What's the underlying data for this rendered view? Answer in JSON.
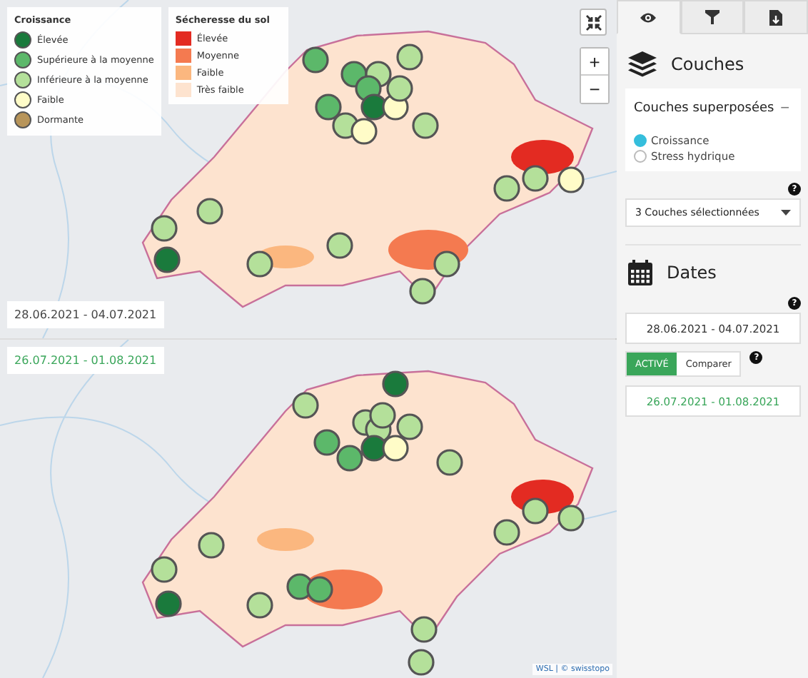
{
  "legend_growth": {
    "title": "Croissance",
    "items": [
      {
        "label": "Élevée",
        "color": "#1a7a3c"
      },
      {
        "label": "Supérieure à la moyenne",
        "color": "#5cb86a"
      },
      {
        "label": "Inférieure à la moyenne",
        "color": "#b4e09a"
      },
      {
        "label": "Faible",
        "color": "#fffcc8"
      },
      {
        "label": "Dormante",
        "color": "#b8955a"
      }
    ]
  },
  "legend_drought": {
    "title": "Sécheresse du sol",
    "items": [
      {
        "label": "Élevée",
        "color": "#e32b22"
      },
      {
        "label": "Moyenne",
        "color": "#f47a50"
      },
      {
        "label": "Faible",
        "color": "#fbb77f"
      },
      {
        "label": "Très faible",
        "color": "#fde3cf"
      }
    ]
  },
  "panels": [
    {
      "date": "28.06.2021 - 04.07.2021",
      "compare": false,
      "markers": [
        {
          "kind": "above"
        },
        {
          "kind": "above"
        },
        {
          "kind": "below"
        },
        {
          "kind": "below"
        },
        {
          "kind": "above"
        },
        {
          "kind": "above"
        },
        {
          "kind": "high"
        },
        {
          "kind": "low"
        },
        {
          "kind": "below"
        },
        {
          "kind": "below"
        },
        {
          "kind": "low"
        },
        {
          "kind": "below"
        },
        {
          "kind": "below"
        },
        {
          "kind": "below"
        },
        {
          "kind": "high"
        },
        {
          "kind": "below"
        },
        {
          "kind": "below"
        },
        {
          "kind": "below"
        },
        {
          "kind": "below"
        },
        {
          "kind": "below"
        },
        {
          "kind": "below"
        },
        {
          "kind": "low"
        }
      ]
    },
    {
      "date": "26.07.2021 - 01.08.2021",
      "compare": true,
      "markers": [
        {
          "kind": "below"
        },
        {
          "kind": "high"
        },
        {
          "kind": "above"
        },
        {
          "kind": "below"
        },
        {
          "kind": "below"
        },
        {
          "kind": "below"
        },
        {
          "kind": "below"
        },
        {
          "kind": "high"
        },
        {
          "kind": "low"
        },
        {
          "kind": "above"
        },
        {
          "kind": "below"
        },
        {
          "kind": "below"
        },
        {
          "kind": "below"
        },
        {
          "kind": "high"
        },
        {
          "kind": "below"
        },
        {
          "kind": "above"
        },
        {
          "kind": "above"
        },
        {
          "kind": "below"
        },
        {
          "kind": "below"
        },
        {
          "kind": "below"
        },
        {
          "kind": "below"
        },
        {
          "kind": "below"
        }
      ]
    }
  ],
  "help": "?",
  "attribution": "WSL | © swisstopo",
  "tabs": [
    {
      "kind": "eye",
      "selected": true
    },
    {
      "kind": "filter",
      "selected": false
    },
    {
      "kind": "file",
      "selected": false
    }
  ],
  "layers": {
    "heading": "Couches",
    "card_title": "Couches superposées",
    "collapse": "−",
    "options": [
      {
        "label": "Croissance",
        "selected": true
      },
      {
        "label": "Stress hydrique",
        "selected": false
      }
    ]
  },
  "dropdown": {
    "value": "3 Couches sélectionnées"
  },
  "dates": {
    "heading": "Dates",
    "range": "28.06.2021 - 04.07.2021",
    "toggle": [
      {
        "label": "ACTIVÉ",
        "selected": true
      },
      {
        "label": "Comparer",
        "selected": false
      }
    ],
    "compare_range": "26.07.2021 - 01.08.2021"
  },
  "zoom": {
    "in": "+",
    "out": "−"
  }
}
